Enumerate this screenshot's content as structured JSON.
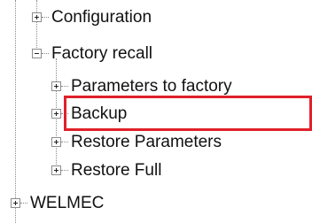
{
  "tree": {
    "items": [
      {
        "label": "Configuration",
        "expander": "plus-icon",
        "level": 1
      },
      {
        "label": "Factory recall",
        "expander": "minus-icon",
        "level": 1
      },
      {
        "label": "Parameters to factory",
        "expander": "plus-icon",
        "level": 2
      },
      {
        "label": "Backup",
        "expander": "plus-icon",
        "level": 2,
        "highlighted": true
      },
      {
        "label": "Restore Parameters",
        "expander": "plus-icon",
        "level": 2
      },
      {
        "label": "Restore Full",
        "expander": "plus-icon",
        "level": 2
      },
      {
        "label": "WELMEC",
        "expander": "plus-icon",
        "level": 0
      }
    ]
  },
  "colors": {
    "highlight": "#e0202a",
    "connector": "#8a8a8a"
  }
}
